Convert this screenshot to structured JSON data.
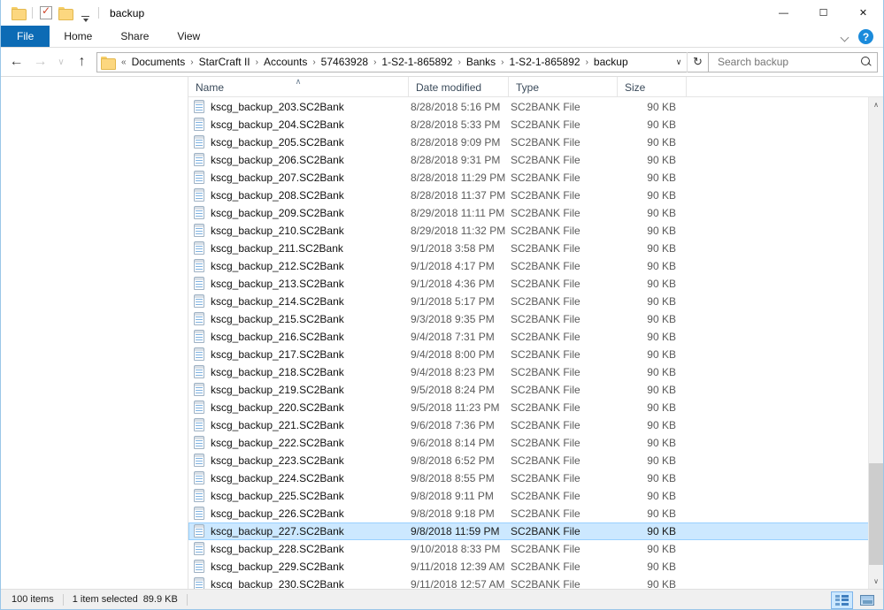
{
  "window": {
    "title": "backup",
    "quick_access": {
      "folder_icon": "folder-icon",
      "properties_icon": "properties-icon",
      "new_folder_icon": "new-folder-icon",
      "customize_icon": "customize-quick-access-icon"
    },
    "controls": {
      "minimize": "—",
      "maximize": "☐",
      "close": "✕"
    }
  },
  "ribbon": {
    "tabs": [
      {
        "label": "File"
      },
      {
        "label": "Home"
      },
      {
        "label": "Share"
      },
      {
        "label": "View"
      }
    ],
    "expand_icon": "chevron-down-icon",
    "help_label": "?"
  },
  "navigation": {
    "back_icon": "←",
    "forward_icon": "→",
    "recent_icon": "∨",
    "up_icon": "↑",
    "refresh_icon": "↻",
    "dropdown_icon": "∨",
    "breadcrumb_prefix": "«",
    "breadcrumbs": [
      "Documents",
      "StarCraft II",
      "Accounts",
      "57463928",
      "1-S2-1-865892",
      "Banks",
      "1-S2-1-865892",
      "backup"
    ],
    "separator": "›"
  },
  "search": {
    "placeholder": "Search backup",
    "value": "",
    "icon": "search-icon"
  },
  "columns": [
    {
      "key": "name",
      "label": "Name",
      "sorted": true,
      "sort_arrow": "∧"
    },
    {
      "key": "date",
      "label": "Date modified",
      "sorted": false
    },
    {
      "key": "type",
      "label": "Type",
      "sorted": false
    },
    {
      "key": "size",
      "label": "Size",
      "sorted": false
    }
  ],
  "files": [
    {
      "name": "kscg_backup_203.SC2Bank",
      "date": "8/28/2018 5:16 PM",
      "type": "SC2BANK File",
      "size": "90 KB",
      "selected": false
    },
    {
      "name": "kscg_backup_204.SC2Bank",
      "date": "8/28/2018 5:33 PM",
      "type": "SC2BANK File",
      "size": "90 KB",
      "selected": false
    },
    {
      "name": "kscg_backup_205.SC2Bank",
      "date": "8/28/2018 9:09 PM",
      "type": "SC2BANK File",
      "size": "90 KB",
      "selected": false
    },
    {
      "name": "kscg_backup_206.SC2Bank",
      "date": "8/28/2018 9:31 PM",
      "type": "SC2BANK File",
      "size": "90 KB",
      "selected": false
    },
    {
      "name": "kscg_backup_207.SC2Bank",
      "date": "8/28/2018 11:29 PM",
      "type": "SC2BANK File",
      "size": "90 KB",
      "selected": false
    },
    {
      "name": "kscg_backup_208.SC2Bank",
      "date": "8/28/2018 11:37 PM",
      "type": "SC2BANK File",
      "size": "90 KB",
      "selected": false
    },
    {
      "name": "kscg_backup_209.SC2Bank",
      "date": "8/29/2018 11:11 PM",
      "type": "SC2BANK File",
      "size": "90 KB",
      "selected": false
    },
    {
      "name": "kscg_backup_210.SC2Bank",
      "date": "8/29/2018 11:32 PM",
      "type": "SC2BANK File",
      "size": "90 KB",
      "selected": false
    },
    {
      "name": "kscg_backup_211.SC2Bank",
      "date": "9/1/2018 3:58 PM",
      "type": "SC2BANK File",
      "size": "90 KB",
      "selected": false
    },
    {
      "name": "kscg_backup_212.SC2Bank",
      "date": "9/1/2018 4:17 PM",
      "type": "SC2BANK File",
      "size": "90 KB",
      "selected": false
    },
    {
      "name": "kscg_backup_213.SC2Bank",
      "date": "9/1/2018 4:36 PM",
      "type": "SC2BANK File",
      "size": "90 KB",
      "selected": false
    },
    {
      "name": "kscg_backup_214.SC2Bank",
      "date": "9/1/2018 5:17 PM",
      "type": "SC2BANK File",
      "size": "90 KB",
      "selected": false
    },
    {
      "name": "kscg_backup_215.SC2Bank",
      "date": "9/3/2018 9:35 PM",
      "type": "SC2BANK File",
      "size": "90 KB",
      "selected": false
    },
    {
      "name": "kscg_backup_216.SC2Bank",
      "date": "9/4/2018 7:31 PM",
      "type": "SC2BANK File",
      "size": "90 KB",
      "selected": false
    },
    {
      "name": "kscg_backup_217.SC2Bank",
      "date": "9/4/2018 8:00 PM",
      "type": "SC2BANK File",
      "size": "90 KB",
      "selected": false
    },
    {
      "name": "kscg_backup_218.SC2Bank",
      "date": "9/4/2018 8:23 PM",
      "type": "SC2BANK File",
      "size": "90 KB",
      "selected": false
    },
    {
      "name": "kscg_backup_219.SC2Bank",
      "date": "9/5/2018 8:24 PM",
      "type": "SC2BANK File",
      "size": "90 KB",
      "selected": false
    },
    {
      "name": "kscg_backup_220.SC2Bank",
      "date": "9/5/2018 11:23 PM",
      "type": "SC2BANK File",
      "size": "90 KB",
      "selected": false
    },
    {
      "name": "kscg_backup_221.SC2Bank",
      "date": "9/6/2018 7:36 PM",
      "type": "SC2BANK File",
      "size": "90 KB",
      "selected": false
    },
    {
      "name": "kscg_backup_222.SC2Bank",
      "date": "9/6/2018 8:14 PM",
      "type": "SC2BANK File",
      "size": "90 KB",
      "selected": false
    },
    {
      "name": "kscg_backup_223.SC2Bank",
      "date": "9/8/2018 6:52 PM",
      "type": "SC2BANK File",
      "size": "90 KB",
      "selected": false
    },
    {
      "name": "kscg_backup_224.SC2Bank",
      "date": "9/8/2018 8:55 PM",
      "type": "SC2BANK File",
      "size": "90 KB",
      "selected": false
    },
    {
      "name": "kscg_backup_225.SC2Bank",
      "date": "9/8/2018 9:11 PM",
      "type": "SC2BANK File",
      "size": "90 KB",
      "selected": false
    },
    {
      "name": "kscg_backup_226.SC2Bank",
      "date": "9/8/2018 9:18 PM",
      "type": "SC2BANK File",
      "size": "90 KB",
      "selected": false
    },
    {
      "name": "kscg_backup_227.SC2Bank",
      "date": "9/8/2018 11:59 PM",
      "type": "SC2BANK File",
      "size": "90 KB",
      "selected": true
    },
    {
      "name": "kscg_backup_228.SC2Bank",
      "date": "9/10/2018 8:33 PM",
      "type": "SC2BANK File",
      "size": "90 KB",
      "selected": false
    },
    {
      "name": "kscg_backup_229.SC2Bank",
      "date": "9/11/2018 12:39 AM",
      "type": "SC2BANK File",
      "size": "90 KB",
      "selected": false
    },
    {
      "name": "kscg_backup_230.SC2Bank",
      "date": "9/11/2018 12:57 AM",
      "type": "SC2BANK File",
      "size": "90 KB",
      "selected": false
    }
  ],
  "scrollbar": {
    "up_icon": "∧",
    "down_icon": "∨",
    "thumb_top_percent": 76,
    "thumb_height_percent": 22
  },
  "status": {
    "item_count": "100 items",
    "selection": "1 item selected",
    "selection_size": "89.9 KB",
    "view_details_icon": "details-view-icon",
    "view_tiles_icon": "large-icons-view-icon"
  },
  "colors": {
    "accent": "#0c6bb5",
    "selection": "#cce8ff",
    "selection_border": "#99d1ff",
    "window_border": "#9ac6e8",
    "help_blue": "#1b8bdb"
  }
}
